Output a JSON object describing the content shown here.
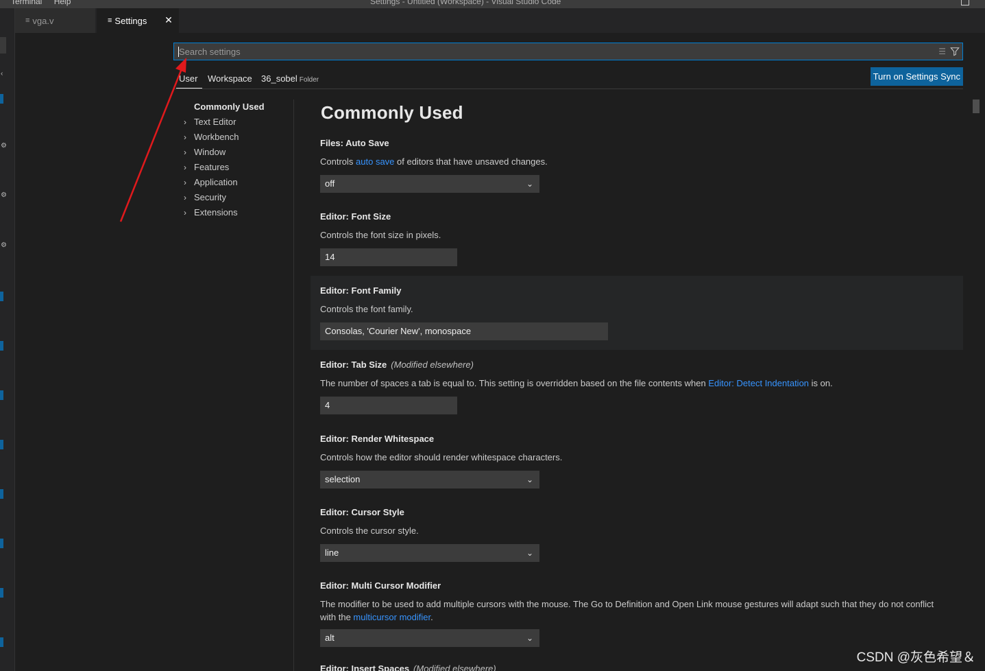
{
  "titlebar": {
    "menu": [
      "Terminal",
      "Help"
    ],
    "window_title": "Settings - Untitled (Workspace) - Visual Studio Code"
  },
  "tabs": [
    {
      "label": "vga.v"
    },
    {
      "label": "Settings"
    }
  ],
  "search": {
    "placeholder": "Search settings",
    "value": ""
  },
  "scopes": {
    "user": "User",
    "workspace": "Workspace",
    "folder": "36_sobel",
    "folder_tag": "Folder",
    "sync_button": "Turn on Settings Sync"
  },
  "toc": [
    {
      "label": "Commonly Used"
    },
    {
      "label": "Text Editor"
    },
    {
      "label": "Workbench"
    },
    {
      "label": "Window"
    },
    {
      "label": "Features"
    },
    {
      "label": "Application"
    },
    {
      "label": "Security"
    },
    {
      "label": "Extensions"
    }
  ],
  "content": {
    "heading": "Commonly Used",
    "settings": [
      {
        "category": "Files: ",
        "name": "Auto Save",
        "desc_before": "Controls ",
        "desc_link": "auto save",
        "desc_after": " of editors that have unsaved changes.",
        "value": "off"
      },
      {
        "category": "Editor: ",
        "name": "Font Size",
        "desc": "Controls the font size in pixels.",
        "value": "14"
      },
      {
        "category": "Editor: ",
        "name": "Font Family",
        "desc": "Controls the font family.",
        "value": "Consolas, 'Courier New', monospace"
      },
      {
        "category": "Editor: ",
        "name": "Tab Size",
        "modified": "(Modified elsewhere)",
        "desc_before": "The number of spaces a tab is equal to. This setting is overridden based on the file contents when ",
        "desc_link": "Editor: Detect Indentation",
        "desc_after": " is on.",
        "value": "4"
      },
      {
        "category": "Editor: ",
        "name": "Render Whitespace",
        "desc": "Controls how the editor should render whitespace characters.",
        "value": "selection"
      },
      {
        "category": "Editor: ",
        "name": "Cursor Style",
        "desc": "Controls the cursor style.",
        "value": "line"
      },
      {
        "category": "Editor: ",
        "name": "Multi Cursor Modifier",
        "desc_before": "The modifier to be used to add multiple cursors with the mouse. The Go to Definition and Open Link mouse gestures will adapt such that they do not conflict with the ",
        "desc_link": "multicursor modifier",
        "desc_after": ".",
        "value": "alt"
      },
      {
        "category": "Editor: ",
        "name": "Insert Spaces",
        "modified": "(Modified elsewhere)"
      }
    ]
  },
  "watermark": "CSDN @灰色希望＆",
  "colors": {
    "accent": "#0e639c",
    "link": "#3794ff",
    "focus_border": "#007fd4",
    "annotation_arrow": "#e0191c"
  }
}
